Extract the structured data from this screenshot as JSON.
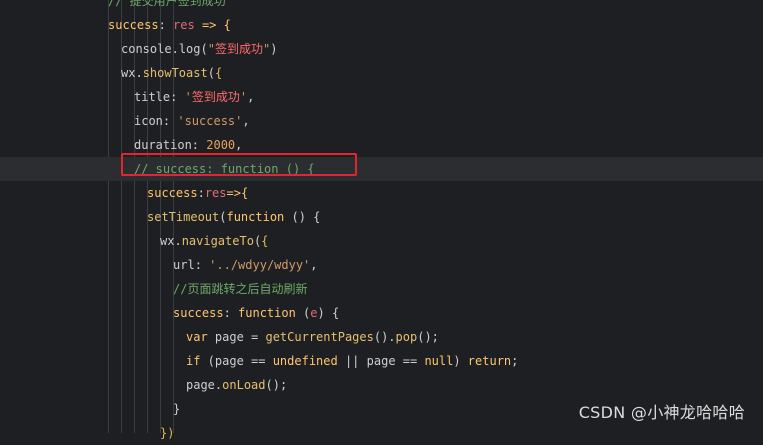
{
  "editor": {
    "lines": [
      {
        "indent": 108,
        "current": false,
        "tokens": [
          {
            "t": "// 提交用户签到成功",
            "c": "cm"
          }
        ]
      },
      {
        "indent": 108,
        "current": false,
        "tokens": [
          {
            "t": "success",
            "c": "kw"
          },
          {
            "t": ": ",
            "c": "op"
          },
          {
            "t": "res",
            "c": "param"
          },
          {
            "t": " => {",
            "c": "kw"
          }
        ]
      },
      {
        "indent": 121,
        "current": false,
        "tokens": [
          {
            "t": "console",
            "c": "pl"
          },
          {
            "t": ".",
            "c": "op"
          },
          {
            "t": "log",
            "c": "pl"
          },
          {
            "t": "(",
            "c": "op"
          },
          {
            "t": "\"",
            "c": "strq"
          },
          {
            "t": "签到成功",
            "c": "cn"
          },
          {
            "t": "\"",
            "c": "strq"
          },
          {
            "t": ")",
            "c": "op"
          }
        ]
      },
      {
        "indent": 121,
        "current": false,
        "tokens": [
          {
            "t": "wx",
            "c": "pl"
          },
          {
            "t": ".",
            "c": "op"
          },
          {
            "t": "showToast",
            "c": "fn"
          },
          {
            "t": "(",
            "c": "op"
          },
          {
            "t": "{",
            "c": "br"
          }
        ]
      },
      {
        "indent": 134,
        "current": false,
        "tokens": [
          {
            "t": "title",
            "c": "pl"
          },
          {
            "t": ": ",
            "c": "op"
          },
          {
            "t": "'",
            "c": "strq"
          },
          {
            "t": "签到成功",
            "c": "cn"
          },
          {
            "t": "'",
            "c": "strq"
          },
          {
            "t": ",",
            "c": "op"
          }
        ]
      },
      {
        "indent": 134,
        "current": false,
        "tokens": [
          {
            "t": "icon",
            "c": "pl"
          },
          {
            "t": ": ",
            "c": "op"
          },
          {
            "t": "'success'",
            "c": "strq"
          },
          {
            "t": ",",
            "c": "op"
          }
        ]
      },
      {
        "indent": 134,
        "current": false,
        "tokens": [
          {
            "t": "duration",
            "c": "pl"
          },
          {
            "t": ": ",
            "c": "op"
          },
          {
            "t": "2000",
            "c": "num"
          },
          {
            "t": ",",
            "c": "op"
          }
        ]
      },
      {
        "indent": 134,
        "current": true,
        "tokens": [
          {
            "t": "// success: function () {",
            "c": "cm"
          }
        ]
      },
      {
        "indent": 147,
        "current": false,
        "tokens": [
          {
            "t": "success",
            "c": "kw"
          },
          {
            "t": ":",
            "c": "op"
          },
          {
            "t": "res",
            "c": "param"
          },
          {
            "t": "=>{",
            "c": "kw"
          }
        ]
      },
      {
        "indent": 147,
        "current": false,
        "tokens": [
          {
            "t": "setTimeout",
            "c": "fn"
          },
          {
            "t": "(",
            "c": "op"
          },
          {
            "t": "function",
            "c": "kw"
          },
          {
            "t": " () {",
            "c": "op"
          }
        ]
      },
      {
        "indent": 160,
        "current": false,
        "tokens": [
          {
            "t": "wx",
            "c": "pl"
          },
          {
            "t": ".",
            "c": "op"
          },
          {
            "t": "navigateTo",
            "c": "fn"
          },
          {
            "t": "(",
            "c": "op"
          },
          {
            "t": "{",
            "c": "br"
          }
        ]
      },
      {
        "indent": 173,
        "current": false,
        "tokens": [
          {
            "t": "url",
            "c": "pl"
          },
          {
            "t": ": ",
            "c": "op"
          },
          {
            "t": "'../wdyy/wdyy'",
            "c": "strq"
          },
          {
            "t": ",",
            "c": "op"
          }
        ]
      },
      {
        "indent": 173,
        "current": false,
        "tokens": [
          {
            "t": "//页面跳转之后自动刷新",
            "c": "cm"
          }
        ]
      },
      {
        "indent": 173,
        "current": false,
        "tokens": [
          {
            "t": "success",
            "c": "kw"
          },
          {
            "t": ": ",
            "c": "op"
          },
          {
            "t": "function",
            "c": "kw"
          },
          {
            "t": " (",
            "c": "op"
          },
          {
            "t": "e",
            "c": "param"
          },
          {
            "t": ") {",
            "c": "op"
          }
        ]
      },
      {
        "indent": 186,
        "current": false,
        "tokens": [
          {
            "t": "var",
            "c": "kw"
          },
          {
            "t": " page = ",
            "c": "pl"
          },
          {
            "t": "getCurrentPages",
            "c": "fn"
          },
          {
            "t": "().",
            "c": "op"
          },
          {
            "t": "pop",
            "c": "fn"
          },
          {
            "t": "();",
            "c": "op"
          }
        ]
      },
      {
        "indent": 186,
        "current": false,
        "tokens": [
          {
            "t": "if",
            "c": "kw"
          },
          {
            "t": " (page == ",
            "c": "pl"
          },
          {
            "t": "undefined",
            "c": "kw"
          },
          {
            "t": " || ",
            "c": "pl"
          },
          {
            "t": "page == ",
            "c": "pl"
          },
          {
            "t": "null",
            "c": "kw"
          },
          {
            "t": ") ",
            "c": "pl"
          },
          {
            "t": "return",
            "c": "kw"
          },
          {
            "t": ";",
            "c": "op"
          }
        ]
      },
      {
        "indent": 186,
        "current": false,
        "tokens": [
          {
            "t": "page",
            "c": "pl"
          },
          {
            "t": ".",
            "c": "op"
          },
          {
            "t": "onLoad",
            "c": "fn"
          },
          {
            "t": "();",
            "c": "op"
          }
        ]
      },
      {
        "indent": 173,
        "current": false,
        "tokens": [
          {
            "t": "}",
            "c": "op"
          }
        ]
      },
      {
        "indent": 160,
        "current": false,
        "tokens": [
          {
            "t": "})",
            "c": "br"
          }
        ]
      }
    ]
  },
  "highlight": {
    "color": "#e0262f"
  },
  "watermark": {
    "text": "CSDN @小神龙哈哈哈"
  }
}
